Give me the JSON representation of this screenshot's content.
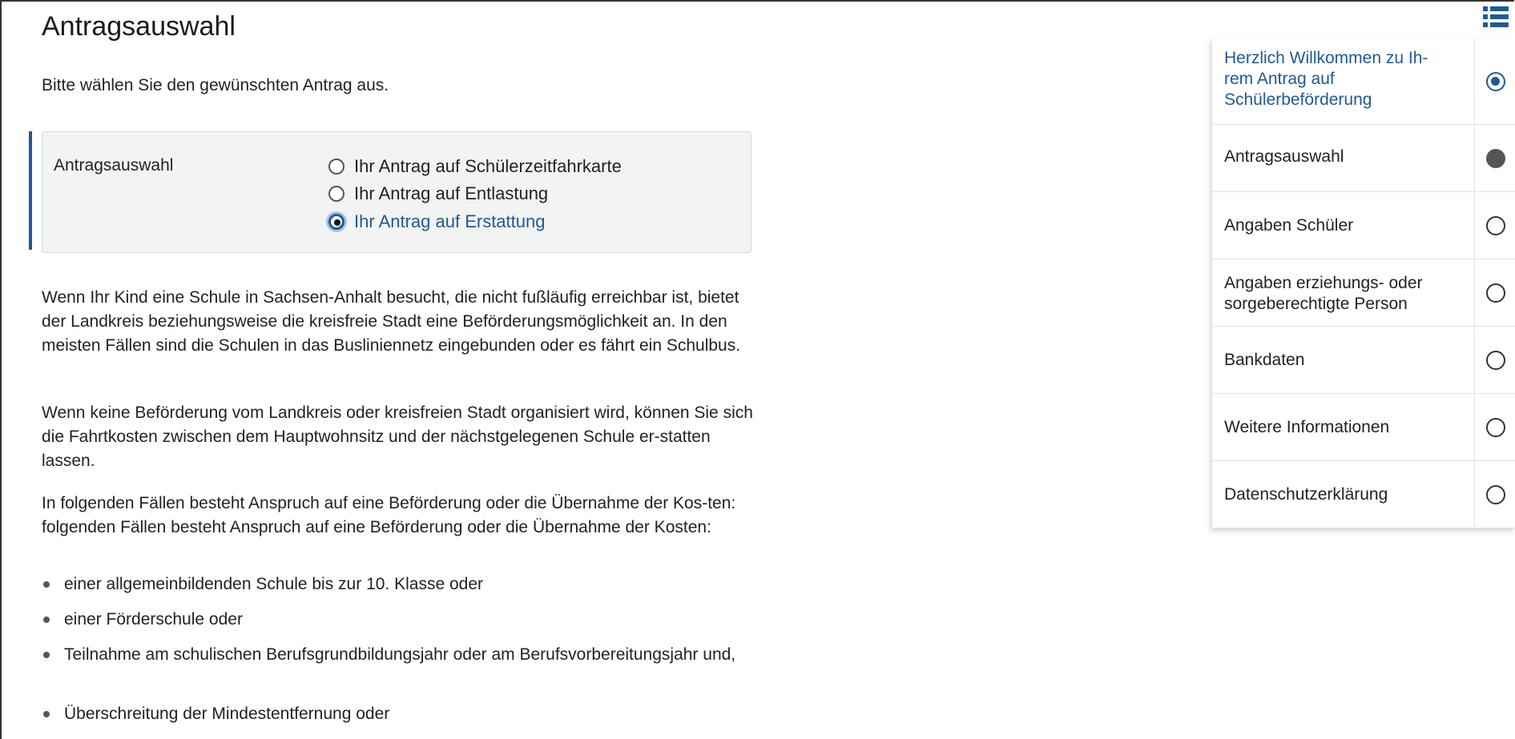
{
  "page": {
    "title": "Antragsauswahl",
    "subtitle": "Bitte wählen Sie den gewünschten Antrag aus."
  },
  "selection": {
    "label": "Antragsauswahl",
    "options": [
      {
        "label": "Ihr Antrag auf Schülerzeitfahrkarte",
        "selected": false
      },
      {
        "label": "Ihr Antrag auf Entlastung",
        "selected": false
      },
      {
        "label": "Ihr Antrag auf Erstattung",
        "selected": true
      }
    ]
  },
  "content": {
    "paragraphs": [
      "Wenn Ihr Kind eine Schule in Sachsen-Anhalt besucht, die nicht fußläufig erreichbar ist, bietet der Landkreis beziehungsweise die kreisfreie Stadt eine Beförderungsmöglichkeit an. In den meisten Fällen sind die Schulen in das Busliniennetz eingebunden oder es fährt ein Schulbus.",
      "Wenn keine Beförderung vom Landkreis oder kreisfreien Stadt organisiert wird, können Sie sich die Fahrtkosten zwischen dem Hauptwohnsitz und der nächstgelegenen Schule er-statten lassen.",
      "In folgenden Fällen besteht Anspruch auf eine Beförderung oder die Übernahme der Kos-ten: folgenden Fällen besteht Anspruch auf eine Beförderung oder die Übernahme der Kosten:"
    ],
    "bullets": [
      "einer allgemeinbildenden Schule bis zur 10. Klasse oder",
      "einer Förderschule oder",
      "Teilnahme am schulischen Berufsgrundbildungsjahr oder am Berufsvorbereitungsjahr und,",
      "Überschreitung der Mindestentfernung oder"
    ]
  },
  "sidebar": {
    "toc_icon": "list-toc-icon",
    "items": [
      {
        "label": "Herzlich Willkommen zu Ih-rem Antrag auf Schülerbeförderung",
        "state": "current"
      },
      {
        "label": "Antragsauswahl",
        "state": "filled"
      },
      {
        "label": "Angaben Schüler",
        "state": "empty"
      },
      {
        "label": "Angaben erziehungs- oder sorgeberechtigte Person",
        "state": "empty"
      },
      {
        "label": "Bankdaten",
        "state": "empty"
      },
      {
        "label": "Weitere Informationen",
        "state": "empty"
      },
      {
        "label": "Datenschutzerklärung",
        "state": "empty"
      }
    ]
  },
  "colors": {
    "accent": "#1f5a96",
    "box_background": "#f2f3f3",
    "text": "#222222"
  }
}
